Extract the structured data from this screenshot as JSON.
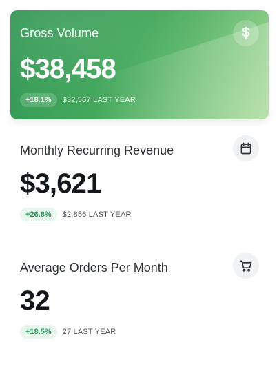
{
  "cards": [
    {
      "title": "Gross Volume",
      "icon": "dollar-icon",
      "value": "$38,458",
      "change_pill": "+18.1%",
      "last_year": "$32,567 LAST YEAR",
      "colors": {
        "gradient_start": "#2f9653",
        "gradient_end": "#a6da93",
        "text": "#ffffff"
      }
    },
    {
      "title": "Monthly Recurring Revenue",
      "icon": "calendar-icon",
      "value": "$3,621",
      "change_pill": "+26.8%",
      "last_year": "$2,856 LAST YEAR",
      "colors": {
        "pill_bg": "#e7f7ed",
        "pill_text": "#1f9a57"
      }
    },
    {
      "title": "Average Orders Per Month",
      "icon": "cart-icon",
      "value": "32",
      "change_pill": "+18.5%",
      "last_year": "27 LAST YEAR",
      "colors": {
        "pill_bg": "#e7f7ed",
        "pill_text": "#1f9a57"
      }
    }
  ]
}
